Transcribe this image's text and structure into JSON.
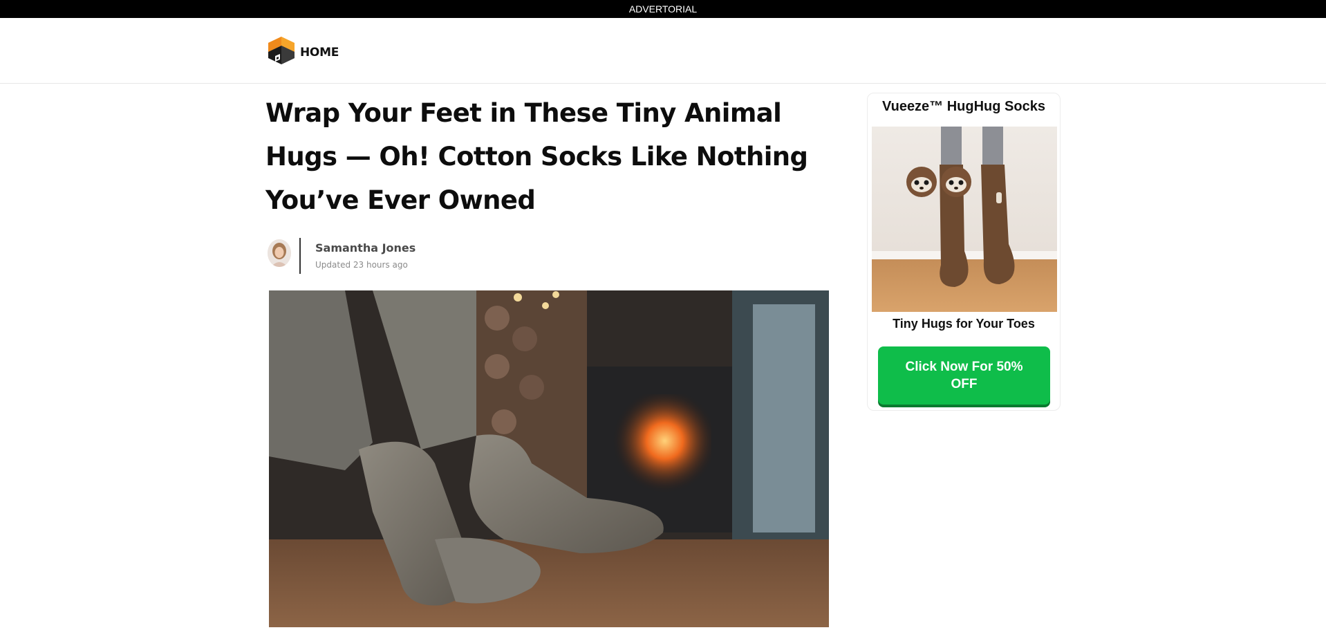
{
  "topbar": {
    "label": "ADVERTORIAL"
  },
  "header": {
    "logo_icon": "house-logo-icon",
    "home_label": "HOME"
  },
  "article": {
    "title": "Wrap Your Feet in These Tiny Animal Hugs — Oh! Cotton Socks Like Nothing You’ve Ever Owned",
    "author": {
      "name": "Samantha Jones",
      "updated": "Updated 23 hours ago"
    },
    "hero_image": "socks-by-fireplace-photo"
  },
  "sidebar": {
    "product_name": "Vueeze™ HugHug Socks",
    "product_image": "sloth-socks-photo",
    "tagline": "Tiny Hugs for Your Toes",
    "cta_label": "Click Now For 50% OFF"
  },
  "colors": {
    "accent_green": "#0fbd4a",
    "logo_orange": "#f5a623",
    "topbar_black": "#000000"
  }
}
